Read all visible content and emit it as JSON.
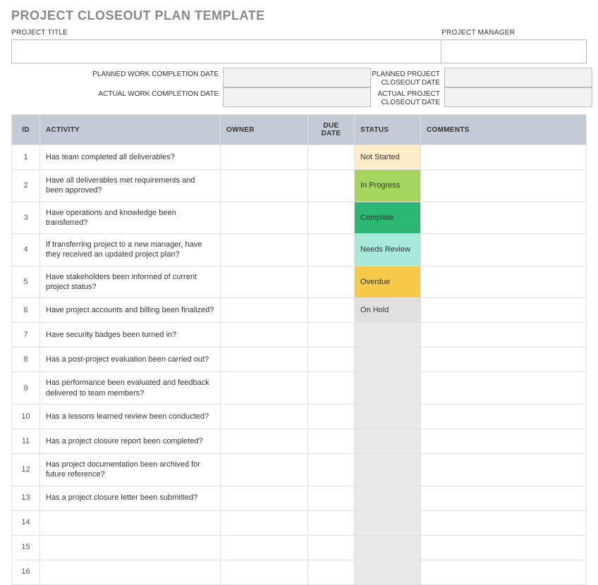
{
  "title": "PROJECT CLOSEOUT PLAN TEMPLATE",
  "header": {
    "project_title_label": "PROJECT TITLE",
    "project_title_value": "",
    "project_manager_label": "PROJECT MANAGER",
    "project_manager_value": ""
  },
  "dates": {
    "planned_work_label": "PLANNED WORK COMPLETION DATE",
    "planned_work_value": "",
    "planned_closeout_label": "PLANNED PROJECT CLOSEOUT DATE",
    "planned_closeout_value": "",
    "actual_work_label": "ACTUAL WORK COMPLETION DATE",
    "actual_work_value": "",
    "actual_closeout_label": "ACTUAL PROJECT CLOSEOUT DATE",
    "actual_closeout_value": ""
  },
  "columns": {
    "id": "ID",
    "activity": "ACTIVITY",
    "owner": "OWNER",
    "due": "DUE DATE",
    "status": "STATUS",
    "comments": "COMMENTS"
  },
  "status_colors": {
    "Not Started": "#fdecc8",
    "In Progress": "#a4d65e",
    "Complete": "#2bb673",
    "Needs Review": "#a6e8dc",
    "Overdue": "#f7c948",
    "On Hold": "#e0e0e0",
    "": "#e8e8e8"
  },
  "rows": [
    {
      "id": "1",
      "activity": "Has team completed all deliverables?",
      "owner": "",
      "due": "",
      "status": "Not Started",
      "comments": ""
    },
    {
      "id": "2",
      "activity": "Have all deliverables met requirements and been approved?",
      "owner": "",
      "due": "",
      "status": "In Progress",
      "comments": ""
    },
    {
      "id": "3",
      "activity": "Have operations and knowledge been transferred?",
      "owner": "",
      "due": "",
      "status": "Complete",
      "comments": ""
    },
    {
      "id": "4",
      "activity": "If transferring project to a new manager, have they received an updated project plan?",
      "owner": "",
      "due": "",
      "status": "Needs Review",
      "comments": ""
    },
    {
      "id": "5",
      "activity": "Have stakeholders been informed of current project status?",
      "owner": "",
      "due": "",
      "status": "Overdue",
      "comments": ""
    },
    {
      "id": "6",
      "activity": "Have project accounts and billing been finalized?",
      "owner": "",
      "due": "",
      "status": "On Hold",
      "comments": ""
    },
    {
      "id": "7",
      "activity": "Have security badges been turned in?",
      "owner": "",
      "due": "",
      "status": "",
      "comments": ""
    },
    {
      "id": "8",
      "activity": "Has a post-project evaluation been carried out?",
      "owner": "",
      "due": "",
      "status": "",
      "comments": ""
    },
    {
      "id": "9",
      "activity": "Has performance been evaluated and feedback delivered to team members?",
      "owner": "",
      "due": "",
      "status": "",
      "comments": ""
    },
    {
      "id": "10",
      "activity": "Has a lessons learned review been conducted?",
      "owner": "",
      "due": "",
      "status": "",
      "comments": ""
    },
    {
      "id": "11",
      "activity": "Has a project closure report been completed?",
      "owner": "",
      "due": "",
      "status": "",
      "comments": ""
    },
    {
      "id": "12",
      "activity": "Has project documentation been archived for future reference?",
      "owner": "",
      "due": "",
      "status": "",
      "comments": ""
    },
    {
      "id": "13",
      "activity": "Has a project closure letter been submitted?",
      "owner": "",
      "due": "",
      "status": "",
      "comments": ""
    },
    {
      "id": "14",
      "activity": "",
      "owner": "",
      "due": "",
      "status": "",
      "comments": ""
    },
    {
      "id": "15",
      "activity": "",
      "owner": "",
      "due": "",
      "status": "",
      "comments": ""
    },
    {
      "id": "16",
      "activity": "",
      "owner": "",
      "due": "",
      "status": "",
      "comments": ""
    }
  ]
}
